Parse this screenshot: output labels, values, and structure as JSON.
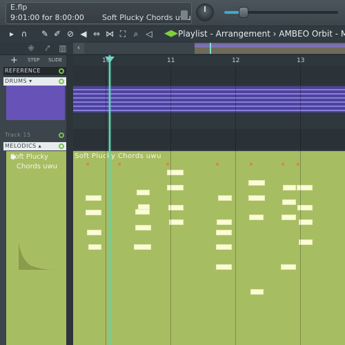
{
  "status": {
    "filename": "E.flp",
    "time": "9:01:00 for 8:00:00",
    "hint_title": "Soft Plucky Chords uwu"
  },
  "toolbar": {
    "playlist_title": "Playlist - Arrangement › AMBEO Orbit - Mu",
    "scroll_left": "‹"
  },
  "tracks": {
    "add": "+",
    "step_label": "STEP",
    "slide_label": "SLIDE",
    "reference": "REFERENCE",
    "drums": "DRUMS ▾",
    "track15": "Track 15",
    "melodics": "MELODICS ▴",
    "melodics_clip_title_line1": "Soft Plucky",
    "melodics_clip_title_line2": "Chords uwu"
  },
  "ruler": {
    "ticks": [
      "10",
      "11",
      "12",
      "13"
    ]
  },
  "clip": {
    "label": "Soft Plucky Chords uwu"
  },
  "colors": {
    "accent_playhead": "#5fd6b2",
    "drums_clip": "#6753b8",
    "melodics_clip": "#a7bd62",
    "note": "#fbfbd6"
  }
}
